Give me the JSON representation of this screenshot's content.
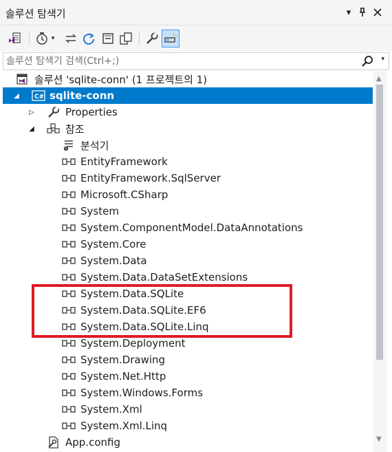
{
  "window": {
    "title": "솔루션 탐색기",
    "controls": [
      "window-position-menu",
      "auto-hide-pin",
      "close"
    ]
  },
  "toolbar": {
    "buttons": [
      {
        "name": "vs-solution-icon"
      },
      {
        "name": "history-icon"
      },
      {
        "name": "sync-icon"
      },
      {
        "name": "refresh-icon"
      },
      {
        "name": "collapse-all-icon"
      },
      {
        "name": "copy-icon"
      },
      {
        "name": "properties-wrench-icon"
      },
      {
        "name": "preview-selected-icon",
        "active": true
      }
    ]
  },
  "search": {
    "placeholder": "솔루션 탐색기 검색(Ctrl+;)",
    "value": ""
  },
  "tree": {
    "solution": "솔루션 'sqlite-conn' (1 프로젝트의 1)",
    "project": "sqlite-conn",
    "properties": "Properties",
    "references_folder": "참조",
    "analyzers": "분석기",
    "references": [
      "EntityFramework",
      "EntityFramework.SqlServer",
      "Microsoft.CSharp",
      "System",
      "System.ComponentModel.DataAnnotations",
      "System.Core",
      "System.Data",
      "System.Data.DataSetExtensions",
      "System.Data.SQLite",
      "System.Data.SQLite.EF6",
      "System.Data.SQLite.Linq",
      "System.Deployment",
      "System.Drawing",
      "System.Net.Http",
      "System.Windows.Forms",
      "System.Xml",
      "System.Xml.Linq"
    ],
    "app_config": "App.config"
  },
  "colors": {
    "selection": "#007acc",
    "highlight_box": "#e01b24",
    "chrome": "#f5f5f5"
  }
}
